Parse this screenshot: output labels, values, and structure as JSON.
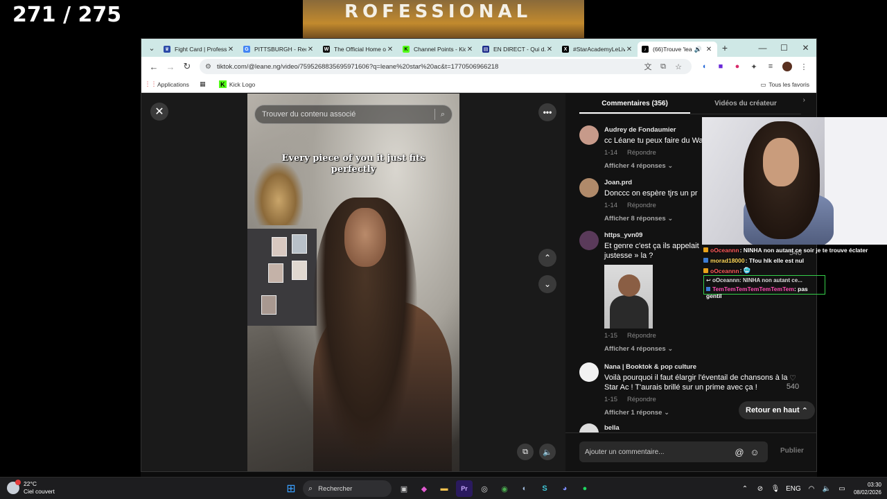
{
  "overlay": {
    "counter": "271 / 275",
    "poster_text": "ROFESSIONAL"
  },
  "browser": {
    "tabs": [
      {
        "title": "Fight Card | Professi...",
        "icon": "crown-icon",
        "color": "#2b4aa8"
      },
      {
        "title": "PITTSBURGH - Rech...",
        "icon": "google-icon",
        "color": "#4285f4"
      },
      {
        "title": "The Official Home o...",
        "icon": "wwe-icon",
        "color": "#111111"
      },
      {
        "title": "Channel Points - Kic...",
        "icon": "kick-icon",
        "color": "#53fc18"
      },
      {
        "title": "EN DIRECT - Qui d...",
        "icon": "news-icon",
        "color": "#1c2b8a"
      },
      {
        "title": "#StarAcademyLeLiv...",
        "icon": "x-icon",
        "color": "#000000"
      },
      {
        "title": "(66)Trouve 'lea",
        "icon": "tiktok-icon",
        "color": "#000000"
      }
    ],
    "url": "tiktok.com/@leane.ng/video/7595268835695971606?q=leane%20star%20ac&t=1770506966218",
    "bookmarks": [
      {
        "label": "Applications",
        "icon": "apps-grid-icon"
      },
      {
        "label": "",
        "icon": "qr-icon"
      },
      {
        "label": "Kick Logo",
        "icon": "kick-icon"
      }
    ],
    "all_bookmarks": "Tous les favoris"
  },
  "player": {
    "search_placeholder": "Trouver du contenu associé",
    "caption": "Every piece of you it just fits perfectly"
  },
  "comments": {
    "tab_comments": "Commentaires (356)",
    "tab_creator": "Vidéos du créateur",
    "items": [
      {
        "user": "Audrey de Fondaumier",
        "text": "cc Léane tu peux faire du Wa",
        "date": "1-14",
        "reply": "Répondre",
        "more": "Afficher 4 réponses",
        "avatar": "#c79a8a"
      },
      {
        "user": "Joan.prd",
        "text": "Donccc on espère tjrs un pr",
        "date": "1-14",
        "reply": "Répondre",
        "more": "Afficher 8 réponses",
        "avatar": "#b08a6a"
      },
      {
        "user": "https_yvn09",
        "text": "Et genre c'est ça ils appelait justesse » la ?",
        "date": "1-15",
        "reply": "Répondre",
        "more": "Afficher 4 réponses",
        "avatar": "#5a3a5a"
      },
      {
        "user": "Nana | Booktok & pop culture",
        "text": "Voilà pourquoi il faut élargir l'éventail de chansons à la Star Ac ! T'aurais brillé sur un prime avec ça !",
        "date": "1-15",
        "reply": "Répondre",
        "more": "Afficher 1 réponse",
        "likes": "540",
        "avatar": "#f2f2f2"
      },
      {
        "user": "bella",
        "avatar": "#dddddd"
      }
    ],
    "hidden_likes": "540",
    "back_to_top": "Retour en haut",
    "add_placeholder": "Ajouter un commentaire...",
    "publish": "Publier"
  },
  "chat": {
    "lines": [
      {
        "user": "oOceannn",
        "text": ": NINHA non autant ce soir je te trouve éclater",
        "color": "#ff5a5a"
      },
      {
        "user": "morad18000",
        "text": ": Tfou hlk elle est nul",
        "color": "#ffd85a"
      },
      {
        "user": "oOceannn",
        "text": ": 🥶",
        "color": "#ff5a5a"
      }
    ],
    "reply_ref": "oOceannn: NINHA non autant ce...",
    "reply_user": "TemTemTemTemTemTemTem",
    "reply_text": ": pas gentil",
    "reply_color": "#ff4db3"
  },
  "taskbar": {
    "temp": "22°C",
    "weather": "Ciel couvert",
    "search": "Rechercher",
    "lang": "ENG",
    "time": "03:30",
    "date": "08/02/2026"
  }
}
